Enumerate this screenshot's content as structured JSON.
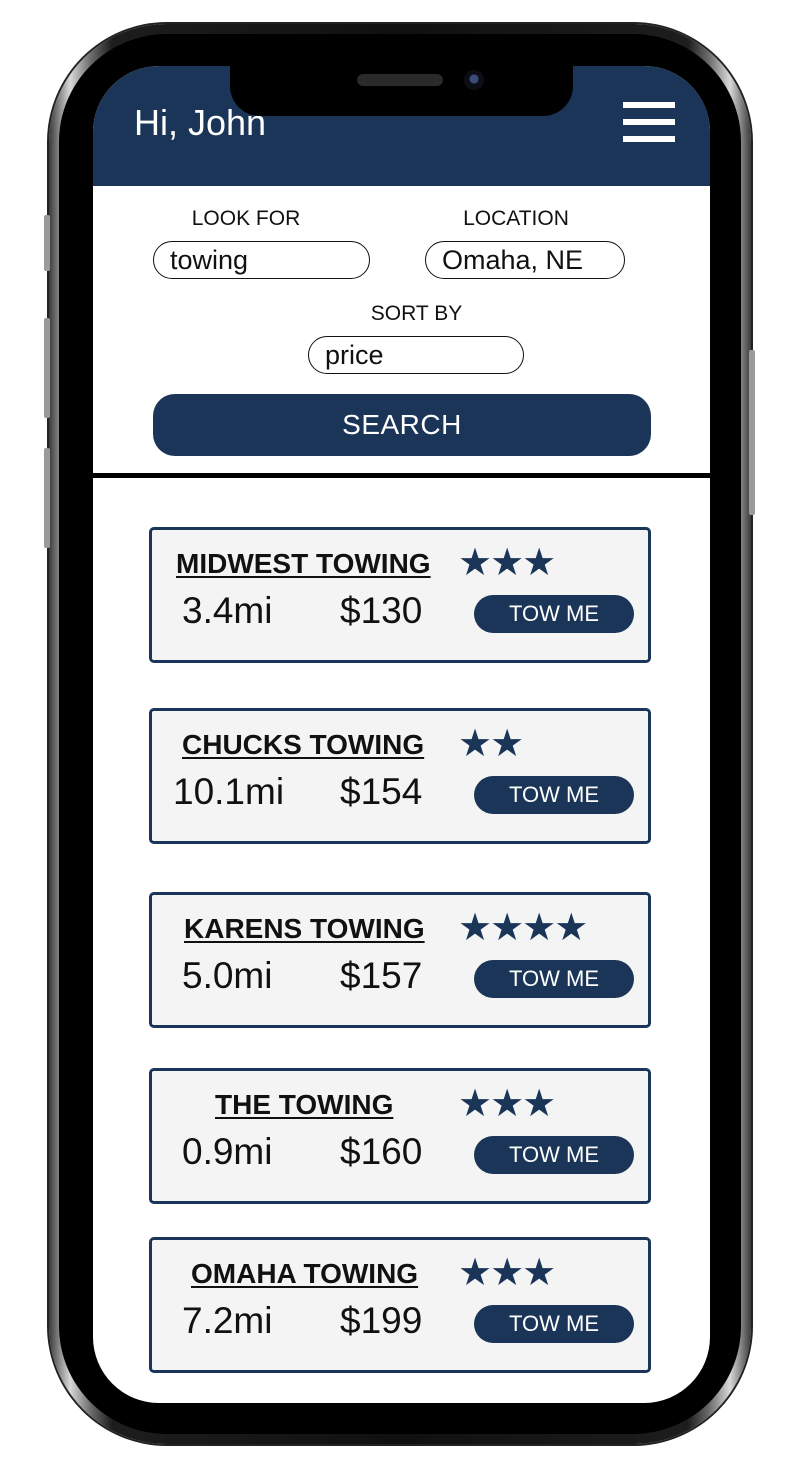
{
  "header": {
    "greeting": "Hi, John",
    "menu_icon": "hamburger-menu-icon"
  },
  "search": {
    "look_for_label": "LOOK FOR",
    "look_for_value": "towing",
    "location_label": "LOCATION",
    "location_value": "Omaha, NE",
    "sort_by_label": "SORT BY",
    "sort_by_value": "price",
    "search_button": "SEARCH"
  },
  "results": [
    {
      "name": "MIDWEST TOWING",
      "rating": 3,
      "stars": "★★★",
      "distance": "3.4mi",
      "price": "$130",
      "action": "TOW ME"
    },
    {
      "name": "CHUCKS TOWING",
      "rating": 2,
      "stars": "★★",
      "distance": "10.1mi",
      "price": "$154",
      "action": "TOW ME"
    },
    {
      "name": "KARENS TOWING",
      "rating": 4,
      "stars": "★★★★",
      "distance": "5.0mi",
      "price": "$157",
      "action": "TOW ME"
    },
    {
      "name": "THE TOWING",
      "rating": 3,
      "stars": "★★★",
      "distance": "0.9mi",
      "price": "$160",
      "action": "TOW ME"
    },
    {
      "name": "OMAHA TOWING",
      "rating": 3,
      "stars": "★★★",
      "distance": "7.2mi",
      "price": "$199",
      "action": "TOW ME"
    }
  ],
  "colors": {
    "primary": "#1a3557",
    "card_background": "#f4f4f4",
    "text": "#111111"
  }
}
